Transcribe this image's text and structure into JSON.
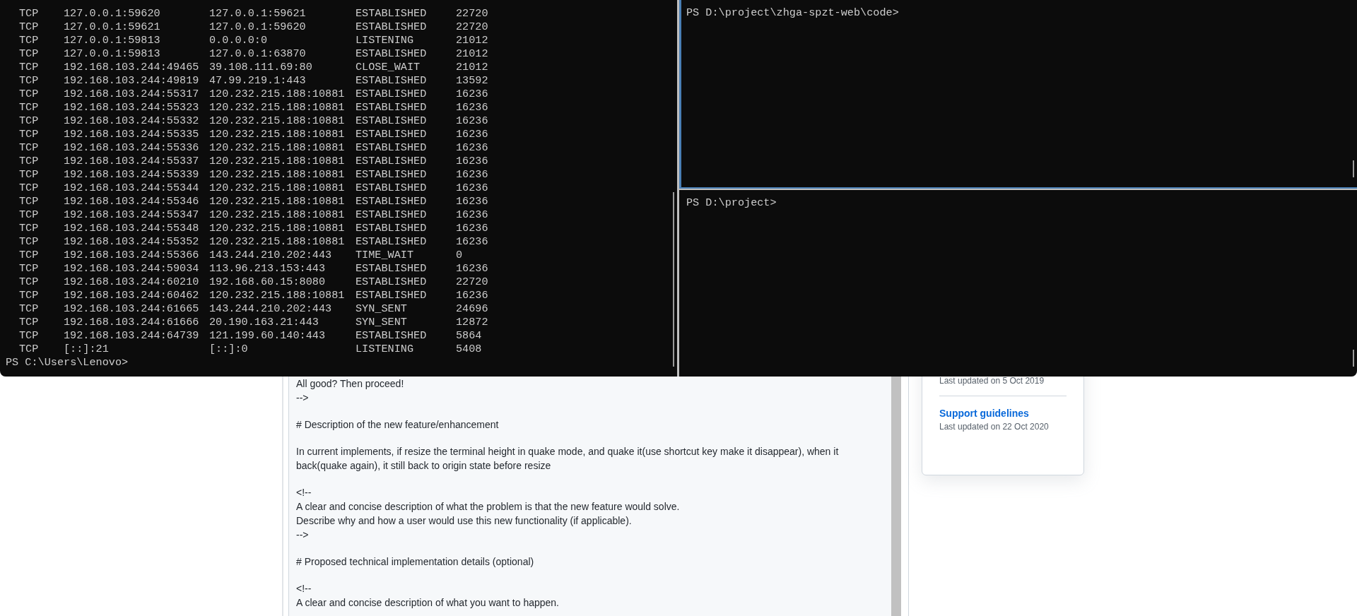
{
  "terminal": {
    "left_pane": {
      "focused": false,
      "rows": [
        {
          "protocol": "TCP",
          "local_address": "127.0.0.1:59620",
          "foreign_address": "127.0.0.1:59621",
          "state": "ESTABLISHED",
          "pid": "22720"
        },
        {
          "protocol": "TCP",
          "local_address": "127.0.0.1:59621",
          "foreign_address": "127.0.0.1:59620",
          "state": "ESTABLISHED",
          "pid": "22720"
        },
        {
          "protocol": "TCP",
          "local_address": "127.0.0.1:59813",
          "foreign_address": "0.0.0.0:0",
          "state": "LISTENING",
          "pid": "21012"
        },
        {
          "protocol": "TCP",
          "local_address": "127.0.0.1:59813",
          "foreign_address": "127.0.0.1:63870",
          "state": "ESTABLISHED",
          "pid": "21012"
        },
        {
          "protocol": "TCP",
          "local_address": "192.168.103.244:49465",
          "foreign_address": "39.108.111.69:80",
          "state": "CLOSE_WAIT",
          "pid": "21012"
        },
        {
          "protocol": "TCP",
          "local_address": "192.168.103.244:49819",
          "foreign_address": "47.99.219.1:443",
          "state": "ESTABLISHED",
          "pid": "13592"
        },
        {
          "protocol": "TCP",
          "local_address": "192.168.103.244:55317",
          "foreign_address": "120.232.215.188:10881",
          "state": "ESTABLISHED",
          "pid": "16236"
        },
        {
          "protocol": "TCP",
          "local_address": "192.168.103.244:55323",
          "foreign_address": "120.232.215.188:10881",
          "state": "ESTABLISHED",
          "pid": "16236"
        },
        {
          "protocol": "TCP",
          "local_address": "192.168.103.244:55332",
          "foreign_address": "120.232.215.188:10881",
          "state": "ESTABLISHED",
          "pid": "16236"
        },
        {
          "protocol": "TCP",
          "local_address": "192.168.103.244:55335",
          "foreign_address": "120.232.215.188:10881",
          "state": "ESTABLISHED",
          "pid": "16236"
        },
        {
          "protocol": "TCP",
          "local_address": "192.168.103.244:55336",
          "foreign_address": "120.232.215.188:10881",
          "state": "ESTABLISHED",
          "pid": "16236"
        },
        {
          "protocol": "TCP",
          "local_address": "192.168.103.244:55337",
          "foreign_address": "120.232.215.188:10881",
          "state": "ESTABLISHED",
          "pid": "16236"
        },
        {
          "protocol": "TCP",
          "local_address": "192.168.103.244:55339",
          "foreign_address": "120.232.215.188:10881",
          "state": "ESTABLISHED",
          "pid": "16236"
        },
        {
          "protocol": "TCP",
          "local_address": "192.168.103.244:55344",
          "foreign_address": "120.232.215.188:10881",
          "state": "ESTABLISHED",
          "pid": "16236"
        },
        {
          "protocol": "TCP",
          "local_address": "192.168.103.244:55346",
          "foreign_address": "120.232.215.188:10881",
          "state": "ESTABLISHED",
          "pid": "16236"
        },
        {
          "protocol": "TCP",
          "local_address": "192.168.103.244:55347",
          "foreign_address": "120.232.215.188:10881",
          "state": "ESTABLISHED",
          "pid": "16236"
        },
        {
          "protocol": "TCP",
          "local_address": "192.168.103.244:55348",
          "foreign_address": "120.232.215.188:10881",
          "state": "ESTABLISHED",
          "pid": "16236"
        },
        {
          "protocol": "TCP",
          "local_address": "192.168.103.244:55352",
          "foreign_address": "120.232.215.188:10881",
          "state": "ESTABLISHED",
          "pid": "16236"
        },
        {
          "protocol": "TCP",
          "local_address": "192.168.103.244:55366",
          "foreign_address": "143.244.210.202:443",
          "state": "TIME_WAIT",
          "pid": "0"
        },
        {
          "protocol": "TCP",
          "local_address": "192.168.103.244:59034",
          "foreign_address": "113.96.213.153:443",
          "state": "ESTABLISHED",
          "pid": "16236"
        },
        {
          "protocol": "TCP",
          "local_address": "192.168.103.244:60210",
          "foreign_address": "192.168.60.15:8080",
          "state": "ESTABLISHED",
          "pid": "22720"
        },
        {
          "protocol": "TCP",
          "local_address": "192.168.103.244:60462",
          "foreign_address": "120.232.215.188:10881",
          "state": "ESTABLISHED",
          "pid": "16236"
        },
        {
          "protocol": "TCP",
          "local_address": "192.168.103.244:61665",
          "foreign_address": "143.244.210.202:443",
          "state": "SYN_SENT",
          "pid": "24696"
        },
        {
          "protocol": "TCP",
          "local_address": "192.168.103.244:61666",
          "foreign_address": "20.190.163.21:443",
          "state": "SYN_SENT",
          "pid": "12872"
        },
        {
          "protocol": "TCP",
          "local_address": "192.168.103.244:64739",
          "foreign_address": "121.199.60.140:443",
          "state": "ESTABLISHED",
          "pid": "5864"
        },
        {
          "protocol": "TCP",
          "local_address": "[::]:21",
          "foreign_address": "[::]:0",
          "state": "LISTENING",
          "pid": "5408"
        }
      ],
      "prompt": "PS C:\\Users\\Lenovo>"
    },
    "right_panes": [
      {
        "focused": true,
        "prompt": "PS D:\\project\\zhga-spzt-web\\code>"
      },
      {
        "focused": false,
        "prompt": "PS D:\\project>"
      }
    ]
  },
  "page": {
    "editor": {
      "blocks": [
        [
          "All good? Then proceed!",
          "-->"
        ],
        [
          "# Description of the new feature/enhancement"
        ],
        [
          "In current implements, if resize the terminal height in quake mode, and quake it(use shortcut key make it disappear), when it back(quake again), it still back to origin state before resize"
        ],
        [
          "<!--",
          "A clear and concise description of what the problem is that the new feature would solve.",
          "Describe why and how a user would use this new functionality (if applicable).",
          "-->"
        ],
        [
          "# Proposed technical implementation details (optional)"
        ],
        [
          "<!--",
          "A clear and concise description of what you want to happen."
        ]
      ]
    },
    "sidebar": {
      "items": [
        {
          "date": "Last updated on 5 Oct 2019"
        },
        {
          "link": "Support guidelines",
          "date": "Last updated on 22 Oct 2020"
        }
      ]
    }
  }
}
